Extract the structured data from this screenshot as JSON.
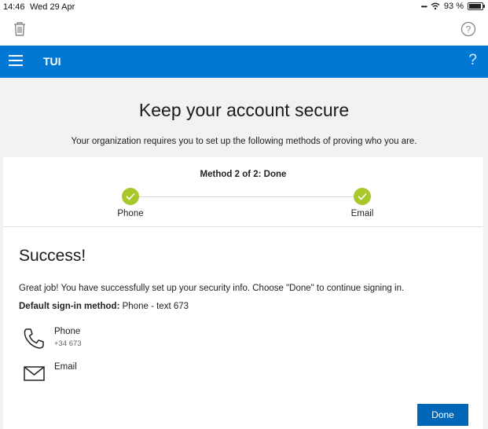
{
  "status_bar": {
    "time": "14:46",
    "date": "Wed 29 Apr",
    "battery": "93 %",
    "battery_level": 0.93
  },
  "toolbar": {
    "trash_icon": "trash-icon",
    "help_icon": "help-circle-icon"
  },
  "app_bar": {
    "title": "TUI",
    "help": "?",
    "bg_color": "#0078d4"
  },
  "page": {
    "heading": "Keep your account secure",
    "subheading": "Your organization requires you to set up the following methods of proving who you are."
  },
  "progress": {
    "method_text": "Method 2 of 2: Done",
    "steps": [
      {
        "label": "Phone",
        "done": true
      },
      {
        "label": "Email",
        "done": true
      }
    ],
    "accent": "#a7c72a"
  },
  "result": {
    "title": "Success!",
    "message": "Great job! You have successfully set up your security info. Choose \"Done\" to continue signing in.",
    "default_label": "Default sign-in method:",
    "default_value": "Phone - text 673",
    "methods": [
      {
        "name": "Phone",
        "detail": "+34 673",
        "icon": "phone-icon"
      },
      {
        "name": "Email",
        "detail": "",
        "icon": "envelope-icon"
      }
    ],
    "done_label": "Done"
  }
}
